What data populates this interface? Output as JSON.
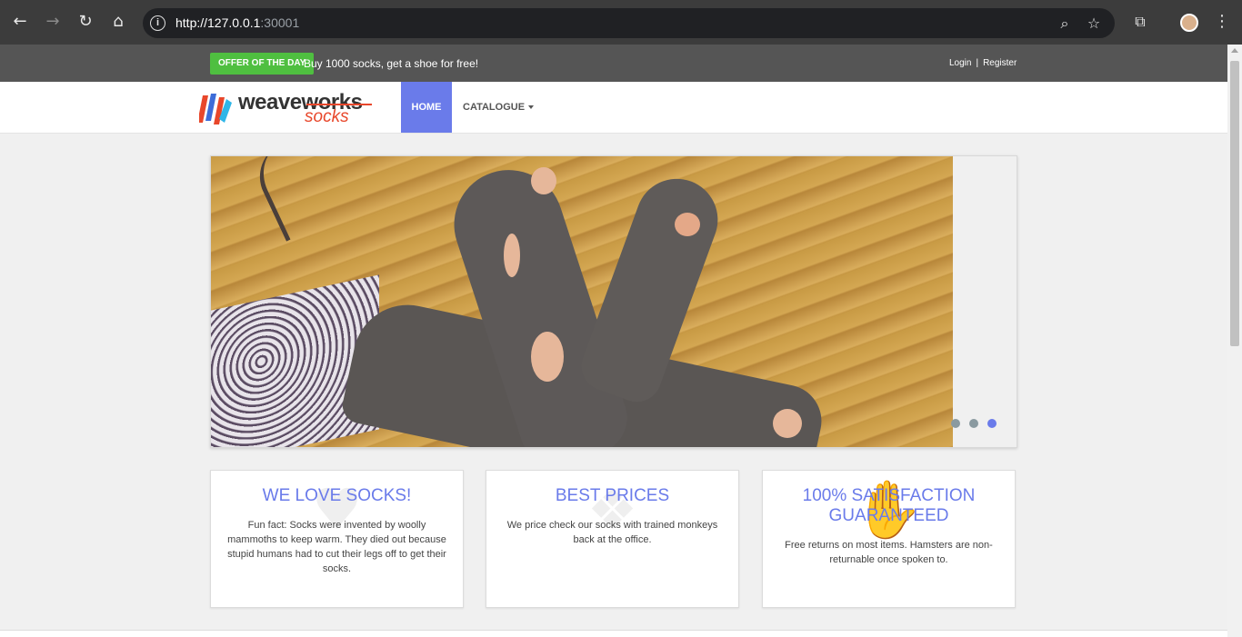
{
  "browser": {
    "url_host": "http://127.0.0.1",
    "url_port": ":30001"
  },
  "topbar": {
    "offer_badge": "OFFER OF THE DAY",
    "offer_text": "Buy 1000 socks, get a shoe for free!",
    "login": "Login",
    "separator": "|",
    "register": "Register"
  },
  "navbar": {
    "logo_primary": "weaveworks",
    "logo_secondary": "socks",
    "home": "HOME",
    "catalogue": "CATALOGUE"
  },
  "carousel": {
    "slide_count": 3,
    "active_index": 2
  },
  "boxes": [
    {
      "title": "WE LOVE SOCKS!",
      "text": "Fun fact: Socks were invented by woolly mammoths to keep warm. They died out because stupid humans had to cut their legs off to get their socks."
    },
    {
      "title": "BEST PRICES",
      "text": "We price check our socks with trained monkeys back at the office."
    },
    {
      "title": "100% SATISFACTION GUARANTEED",
      "text": "Free returns on most items. Hamsters are non-returnable once spoken to."
    }
  ],
  "colors": {
    "accent": "#6a7bea",
    "offer_green": "#4fbf40",
    "topbar": "#555555"
  }
}
